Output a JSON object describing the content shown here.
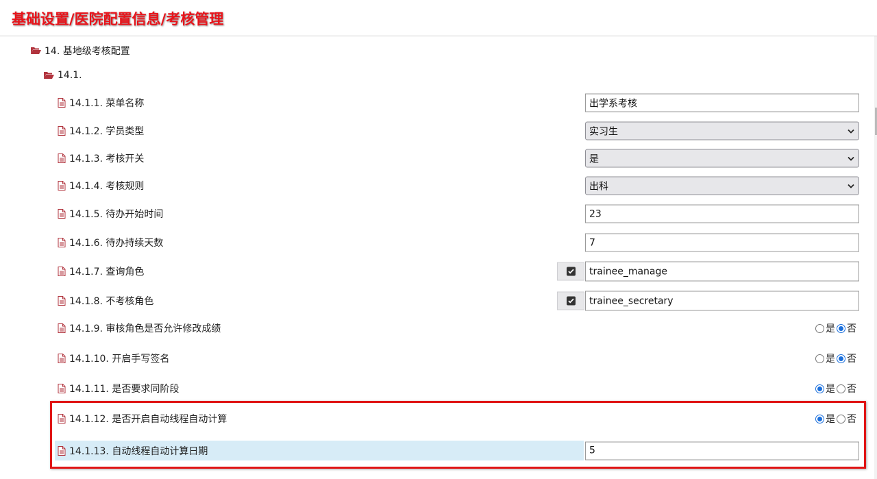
{
  "header": {
    "title": "基础设置/医院配置信息/考核管理"
  },
  "tree": {
    "section_label": "14. 基地级考核配置",
    "subsection_label": "14.1."
  },
  "items": [
    {
      "label": "14.1.1. 菜单名称",
      "value": "出学系考核"
    },
    {
      "label": "14.1.2. 学员类型",
      "value": "实习生"
    },
    {
      "label": "14.1.3. 考核开关",
      "value": "是"
    },
    {
      "label": "14.1.4. 考核规则",
      "value": "出科"
    },
    {
      "label": "14.1.5. 待办开始时间",
      "value": "23"
    },
    {
      "label": "14.1.6. 待办持续天数",
      "value": "7"
    },
    {
      "label": "14.1.7. 查询角色",
      "value": "trainee_manage"
    },
    {
      "label": "14.1.8. 不考核角色",
      "value": "trainee_secretary"
    },
    {
      "label": "14.1.9. 审核角色是否允许修改成绩",
      "selected": "否"
    },
    {
      "label": "14.1.10. 开启手写签名",
      "selected": "否"
    },
    {
      "label": "14.1.11. 是否要求同阶段",
      "selected": "是"
    },
    {
      "label": "14.1.12. 是否开启自动线程自动计算",
      "selected": "是"
    },
    {
      "label": "14.1.13. 自动线程自动计算日期",
      "value": "5"
    }
  ],
  "radio_options": {
    "yes": "是",
    "no": "否"
  },
  "icons": {
    "folder": "folder-open-icon",
    "document": "document-icon",
    "dropdown": "chevron-down-icon",
    "checkbox": "checkbox-checked-icon"
  },
  "colors": {
    "title": "#e8141b",
    "icon": "#b1333d",
    "radio_checked": "#1a6fdc",
    "highlight_row": "#d7ecf7",
    "annotation_border": "#e01515"
  }
}
